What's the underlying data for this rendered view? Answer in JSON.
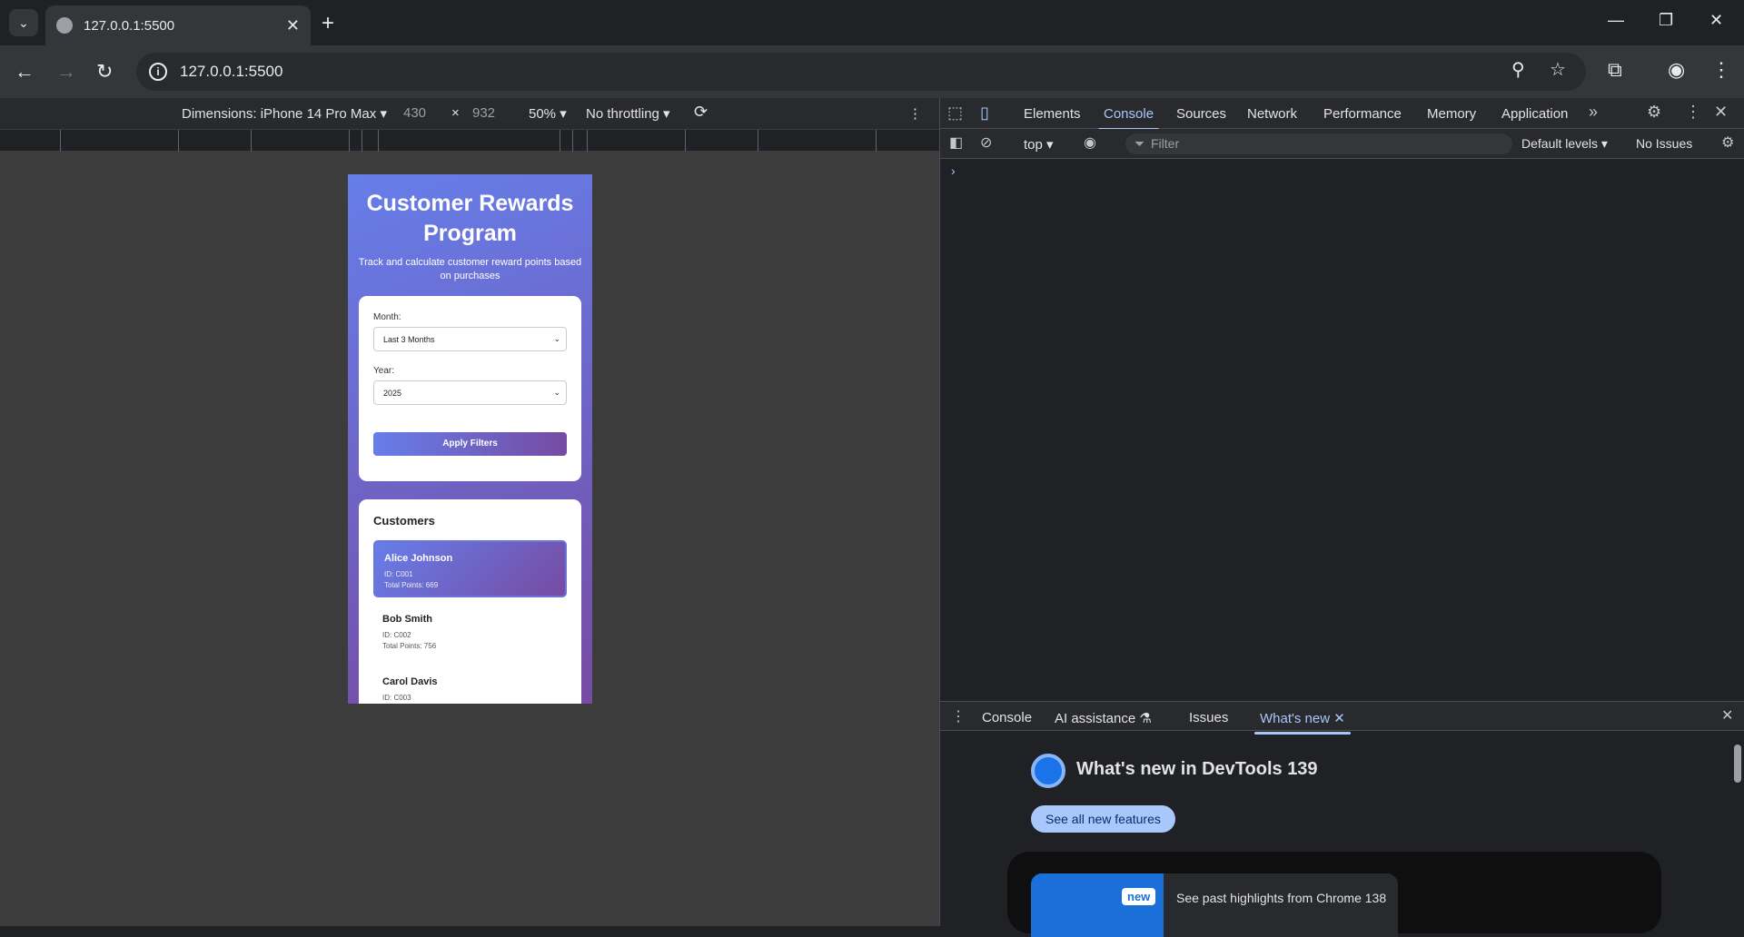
{
  "browser": {
    "tab_title": "127.0.0.1:5500",
    "url": "127.0.0.1:5500"
  },
  "device_toolbar": {
    "dimensions_label": "Dimensions: iPhone 14 Pro Max",
    "width": "430",
    "times": "×",
    "height": "932",
    "zoom": "50%",
    "throttling": "No throttling"
  },
  "app": {
    "title": "Customer Rewards Program",
    "subtitle": "Track and calculate customer reward points based on purchases",
    "filters": {
      "month_label": "Month:",
      "month_value": "Last 3 Months",
      "year_label": "Year:",
      "year_value": "2025",
      "apply_label": "Apply Filters"
    },
    "customers_heading": "Customers",
    "customers": [
      {
        "name": "Alice Johnson",
        "id": "ID: C001",
        "points": "Total Points: 669"
      },
      {
        "name": "Bob Smith",
        "id": "ID: C002",
        "points": "Total Points: 756"
      },
      {
        "name": "Carol Davis",
        "id": "ID: C003",
        "points": ""
      }
    ]
  },
  "devtools": {
    "tabs": [
      "Elements",
      "Console",
      "Sources",
      "Network",
      "Performance",
      "Memory",
      "Application"
    ],
    "context": "top",
    "filter_placeholder": "Filter",
    "levels": "Default levels",
    "issues": "No Issues",
    "drawer_tabs": [
      "Console",
      "AI assistance",
      "Issues",
      "What's new"
    ],
    "whats_new_title": "What's new in DevTools 139",
    "see_all": "See all new features",
    "new_badge": "new",
    "highlight_text": "See past highlights from Chrome 138"
  }
}
